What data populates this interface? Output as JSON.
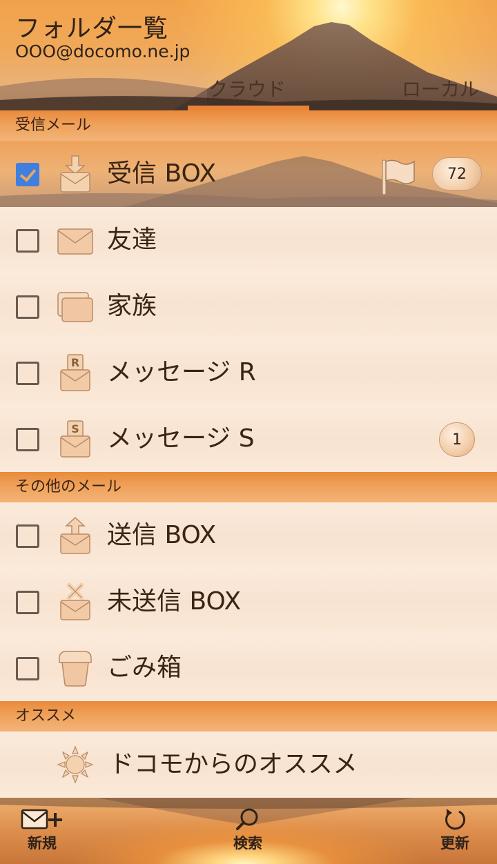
{
  "header": {
    "title": "フォルダ一覧",
    "account": "OOO@docomo.ne.jp",
    "tabs": [
      {
        "label": "クラウド",
        "active": true
      },
      {
        "label": "ローカル",
        "active": false
      }
    ]
  },
  "sections": {
    "inbox": "受信メール",
    "other": "その他のメール",
    "recommend": "オススメ"
  },
  "folders": [
    {
      "label": "受信 BOX",
      "checked": true,
      "icon": "inbox-download-icon",
      "badge": "72",
      "flag": true
    },
    {
      "label": "友達",
      "checked": false,
      "icon": "envelope-icon"
    },
    {
      "label": "家族",
      "checked": false,
      "icon": "folder-stack-icon"
    },
    {
      "label": "メッセージ R",
      "checked": false,
      "icon": "message-r-icon"
    },
    {
      "label": "メッセージ S",
      "checked": false,
      "icon": "message-s-icon",
      "badge": "1"
    },
    {
      "label": "送信 BOX",
      "checked": false,
      "icon": "outbox-upload-icon"
    },
    {
      "label": "未送信 BOX",
      "checked": false,
      "icon": "unsent-x-icon"
    },
    {
      "label": "ごみ箱",
      "checked": false,
      "icon": "trash-icon"
    },
    {
      "label": "ドコモからのオススメ",
      "icon": "sun-icon"
    }
  ],
  "bottom_bar": {
    "new_label": "新規",
    "search_label": "検索",
    "refresh_label": "更新"
  },
  "colors": {
    "accent": "#e8843a",
    "checkbox_checked": "#3f7fe0",
    "icon_fill": "#f0c9a4"
  }
}
